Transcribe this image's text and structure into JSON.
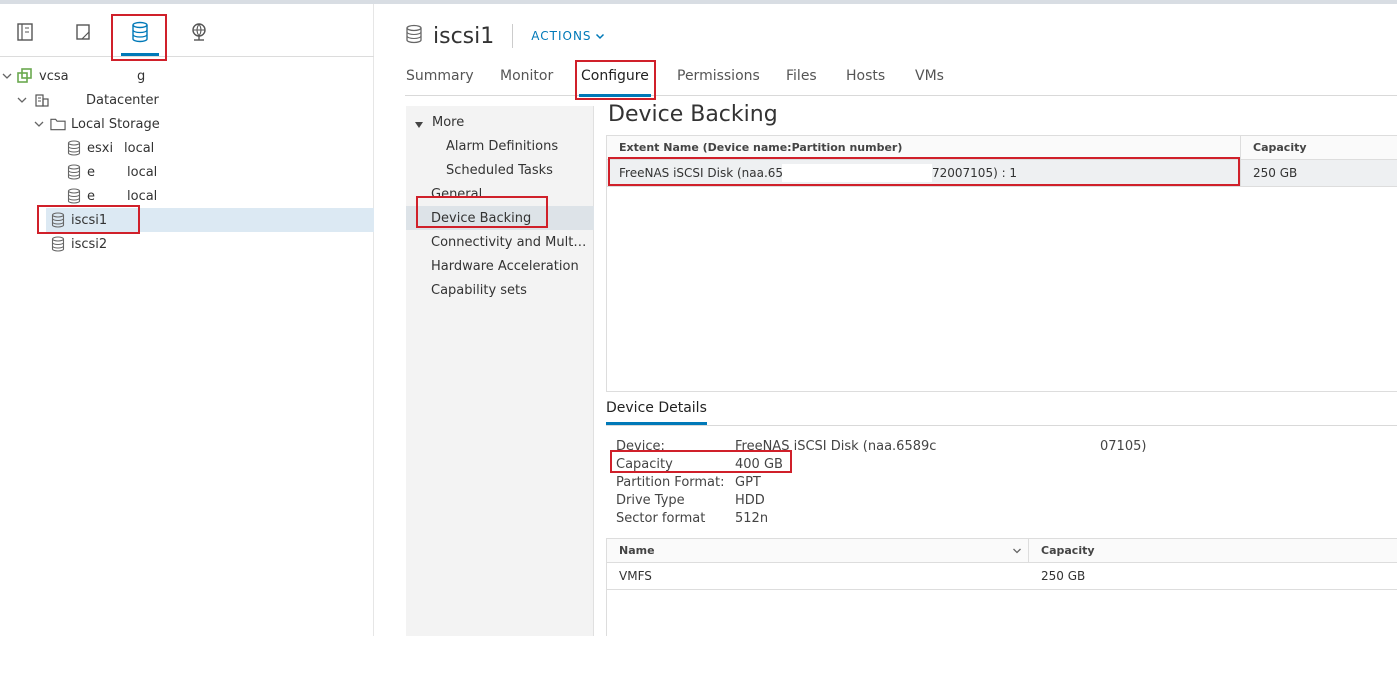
{
  "navigator": {
    "icons": [
      "hosts-clusters-icon",
      "vms-templates-icon",
      "storage-icon",
      "networking-icon"
    ],
    "tree": [
      {
        "label": "vcsa",
        "suffix": "g",
        "indent": 0
      },
      {
        "label": "Datacenter",
        "indent": 1
      },
      {
        "label": "Local Storage",
        "indent": 2
      },
      {
        "label": "esxi",
        "suffix": "local",
        "indent": 3
      },
      {
        "label": "e",
        "suffix": "local",
        "indent": 3
      },
      {
        "label": "e",
        "suffix": "local",
        "indent": 3
      },
      {
        "label": "iscsi1",
        "indent": 2,
        "selected": true
      },
      {
        "label": "iscsi2",
        "indent": 2
      }
    ]
  },
  "header": {
    "title": "iscsi1",
    "actions_label": "ACTIONS"
  },
  "tabs": [
    "Summary",
    "Monitor",
    "Configure",
    "Permissions",
    "Files",
    "Hosts",
    "VMs"
  ],
  "active_tab": "Configure",
  "subnav": {
    "more_label": "More",
    "items": [
      "Alarm Definitions",
      "Scheduled Tasks",
      "General",
      "Device Backing",
      "Connectivity and Multipathing",
      "Hardware Acceleration",
      "Capability sets"
    ],
    "selected": "Device Backing"
  },
  "device_backing": {
    "title": "Device Backing",
    "columns": [
      "Extent Name (Device name:Partition number)",
      "Capacity"
    ],
    "rows": [
      {
        "extent_start": "FreeNAS iSCSI Disk (naa.658",
        "extent_end": "72007105) : 1",
        "capacity": "250 GB"
      }
    ]
  },
  "device_details": {
    "tab_label": "Device Details",
    "fields": [
      {
        "key": "Device:",
        "value": "FreeNAS iSCSI Disk (naa.6589c",
        "value_tail": "07105)"
      },
      {
        "key": "Capacity",
        "value": "400 GB"
      },
      {
        "key": "Partition Format:",
        "value": "GPT"
      },
      {
        "key": "Drive Type",
        "value": "HDD"
      },
      {
        "key": "Sector format",
        "value": "512n"
      }
    ],
    "partitions": {
      "columns": [
        "Name",
        "Capacity"
      ],
      "rows": [
        {
          "name": "VMFS",
          "capacity": "250 GB"
        }
      ]
    }
  },
  "colors": {
    "accent": "#0079b8",
    "highlight": "#d0202a",
    "selected_row": "#dce9f3"
  }
}
